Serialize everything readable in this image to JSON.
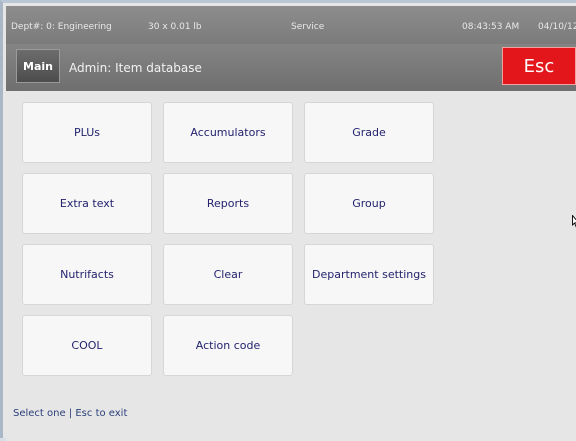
{
  "status": {
    "dept": "Dept#: 0: Engineering",
    "weight": "30 x 0.01 lb",
    "mode": "Service",
    "time": "08:43:53 AM",
    "date": "04/10/12"
  },
  "header": {
    "main_label": "Main",
    "title": "Admin: Item database",
    "esc_label": "Esc"
  },
  "menu": {
    "items": [
      {
        "label": "PLUs"
      },
      {
        "label": "Accumulators"
      },
      {
        "label": "Grade"
      },
      {
        "label": "Extra text"
      },
      {
        "label": "Reports"
      },
      {
        "label": "Group"
      },
      {
        "label": "Nutrifacts"
      },
      {
        "label": "Clear"
      },
      {
        "label": "Department settings"
      },
      {
        "label": "COOL"
      },
      {
        "label": "Action code"
      }
    ]
  },
  "footer": {
    "hint": "Select one | Esc to exit"
  },
  "colors": {
    "esc": "#e3161c",
    "tile_text": "#23236e"
  }
}
